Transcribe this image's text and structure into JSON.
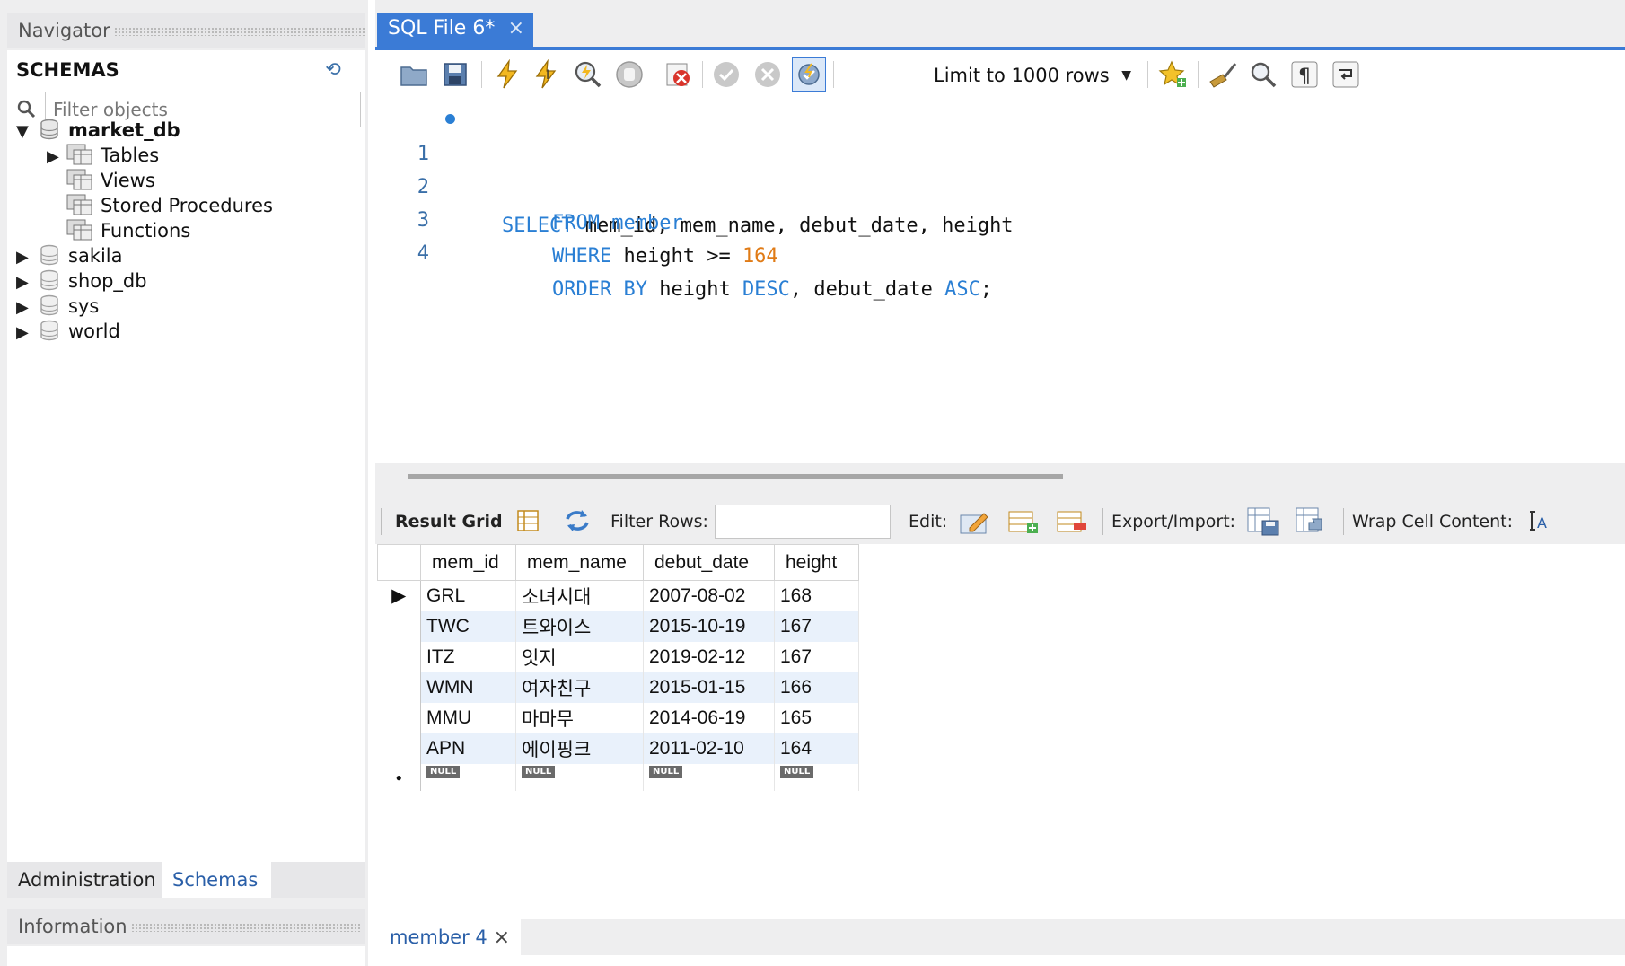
{
  "navigator": {
    "title": "Navigator",
    "schemas_label": "SCHEMAS",
    "filter_placeholder": "Filter objects",
    "tree": {
      "market_db": {
        "name": "market_db",
        "children": [
          "Tables",
          "Views",
          "Stored Procedures",
          "Functions"
        ]
      },
      "other_schemas": [
        "sakila",
        "shop_db",
        "sys",
        "world"
      ]
    },
    "tabs": {
      "administration": "Administration",
      "schemas": "Schemas"
    },
    "information_title": "Information"
  },
  "editor": {
    "tab_label": "SQL File 6*",
    "limit_select": "Limit to 1000 rows",
    "line_numbers": [
      "1",
      "2",
      "3",
      "4"
    ],
    "code": {
      "l1_kw": "SELECT",
      "l1_rest": " mem_id, mem_name, debut_date, height",
      "l2_kw": "FROM",
      "l2_table": "member",
      "l3_kw": "WHERE",
      "l3_col": " height >= ",
      "l3_num": "164",
      "l4_kw1": "ORDER BY",
      "l4_col1": " height ",
      "l4_kw2": "DESC",
      "l4_col2": ", debut_date ",
      "l4_kw3": "ASC",
      "l4_end": ";"
    }
  },
  "result_toolbar": {
    "result_grid": "Result Grid",
    "filter_rows": "Filter Rows:",
    "edit": "Edit:",
    "export_import": "Export/Import:",
    "wrap_cell": "Wrap Cell Content:"
  },
  "grid": {
    "columns": [
      "mem_id",
      "mem_name",
      "debut_date",
      "height"
    ],
    "rows": [
      [
        "GRL",
        "소녀시대",
        "2007-08-02",
        "168"
      ],
      [
        "TWC",
        "트와이스",
        "2015-10-19",
        "167"
      ],
      [
        "ITZ",
        "잇지",
        "2019-02-12",
        "167"
      ],
      [
        "WMN",
        "여자친구",
        "2015-01-15",
        "166"
      ],
      [
        "MMU",
        "마마무",
        "2014-06-19",
        "165"
      ],
      [
        "APN",
        "에이핑크",
        "2011-02-10",
        "164"
      ]
    ],
    "null_label": "NULL",
    "current_row_marker": "▶",
    "new_row_marker": "●"
  },
  "bottom_tab": {
    "label": "member 4"
  },
  "colors": {
    "accent": "#3b7bd6",
    "keyword": "#2a7fd4",
    "number": "#e07b16",
    "row_alt": "#e9f1fb"
  }
}
